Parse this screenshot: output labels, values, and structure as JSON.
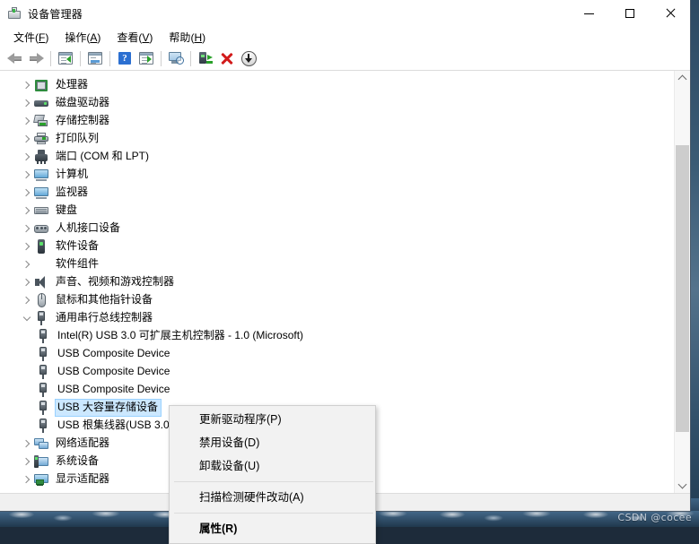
{
  "window": {
    "title": "设备管理器",
    "icon": "device-manager-icon",
    "controls": {
      "minimize": "—",
      "maximize": "□",
      "close": "✕"
    }
  },
  "menubar": {
    "items": [
      {
        "label": "文件",
        "accel": "F"
      },
      {
        "label": "操作",
        "accel": "A"
      },
      {
        "label": "查看",
        "accel": "V"
      },
      {
        "label": "帮助",
        "accel": "H"
      }
    ]
  },
  "toolbar": {
    "buttons": [
      {
        "name": "back-icon",
        "tip": "后退"
      },
      {
        "name": "forward-icon",
        "tip": "前进"
      },
      {
        "name": "show-hidden-devices-icon",
        "tip": "显示隐藏的设备"
      },
      {
        "name": "properties-icon",
        "tip": "属性"
      },
      {
        "name": "help-icon",
        "tip": "帮助"
      },
      {
        "name": "scan-for-hardware-changes-icon",
        "tip": "扫描检测硬件改动"
      },
      {
        "name": "display-icon",
        "tip": "显示"
      },
      {
        "name": "update-driver-icon",
        "tip": "更新驱动程序"
      },
      {
        "name": "uninstall-device-icon",
        "tip": "卸载设备"
      },
      {
        "name": "download-icon",
        "tip": "下载"
      }
    ]
  },
  "tree": {
    "nodes": [
      {
        "label": "处理器",
        "icon": "ic-cpu",
        "state": "collapsed",
        "level": 1
      },
      {
        "label": "磁盘驱动器",
        "icon": "ic-disk",
        "state": "collapsed",
        "level": 1
      },
      {
        "label": "存储控制器",
        "icon": "ic-stor",
        "state": "collapsed",
        "level": 1
      },
      {
        "label": "打印队列",
        "icon": "ic-print",
        "state": "collapsed",
        "level": 1
      },
      {
        "label": "端口 (COM 和 LPT)",
        "icon": "ic-port",
        "state": "collapsed",
        "level": 1
      },
      {
        "label": "计算机",
        "icon": "ic-mon",
        "state": "collapsed",
        "level": 1
      },
      {
        "label": "监视器",
        "icon": "ic-mon",
        "state": "collapsed",
        "level": 1
      },
      {
        "label": "键盘",
        "icon": "ic-kbd",
        "state": "collapsed",
        "level": 1
      },
      {
        "label": "人机接口设备",
        "icon": "ic-hid",
        "state": "collapsed",
        "level": 1
      },
      {
        "label": "软件设备",
        "icon": "ic-sw",
        "state": "collapsed",
        "level": 1
      },
      {
        "label": "软件组件",
        "icon": "ic-sw-plus",
        "state": "collapsed",
        "level": 1
      },
      {
        "label": "声音、视频和游戏控制器",
        "icon": "ic-snd",
        "state": "collapsed",
        "level": 1
      },
      {
        "label": "鼠标和其他指针设备",
        "icon": "ic-mouse",
        "state": "collapsed",
        "level": 1
      },
      {
        "label": "通用串行总线控制器",
        "icon": "ic-usb",
        "state": "expanded",
        "level": 1
      },
      {
        "label": "Intel(R) USB 3.0 可扩展主机控制器 - 1.0 (Microsoft)",
        "icon": "ic-usb",
        "state": "leaf",
        "level": 2
      },
      {
        "label": "USB Composite Device",
        "icon": "ic-usb",
        "state": "leaf",
        "level": 2
      },
      {
        "label": "USB Composite Device",
        "icon": "ic-usb",
        "state": "leaf",
        "level": 2
      },
      {
        "label": "USB Composite Device",
        "icon": "ic-usb",
        "state": "leaf",
        "level": 2
      },
      {
        "label": "USB 大容量存储设备",
        "icon": "ic-usb",
        "state": "leaf",
        "level": 2,
        "selected": true
      },
      {
        "label": "USB 根集线器(USB 3.0)",
        "icon": "ic-usb",
        "state": "leaf",
        "level": 2
      },
      {
        "label": "网络适配器",
        "icon": "ic-net",
        "state": "collapsed",
        "level": 1
      },
      {
        "label": "系统设备",
        "icon": "ic-sys",
        "state": "collapsed",
        "level": 1
      },
      {
        "label": "显示适配器",
        "icon": "ic-disp",
        "state": "collapsed",
        "level": 1
      }
    ]
  },
  "context_menu": {
    "items": [
      {
        "label": "更新驱动程序(P)",
        "bold": false,
        "separator_after": false
      },
      {
        "label": "禁用设备(D)",
        "bold": false,
        "separator_after": false
      },
      {
        "label": "卸载设备(U)",
        "bold": false,
        "separator_after": true
      },
      {
        "label": "扫描检测硬件改动(A)",
        "bold": false,
        "separator_after": true
      },
      {
        "label": "属性(R)",
        "bold": true,
        "separator_after": false
      }
    ]
  },
  "watermark": {
    "text": "CSDN @cocee"
  },
  "colors": {
    "selection": "#cce8ff",
    "accent_green": "#2aa12a",
    "accent_red": "#d21b1b",
    "accent_blue": "#2b6fd1",
    "window_bg": "#ffffff",
    "menu_bg": "#f2f2f2"
  }
}
